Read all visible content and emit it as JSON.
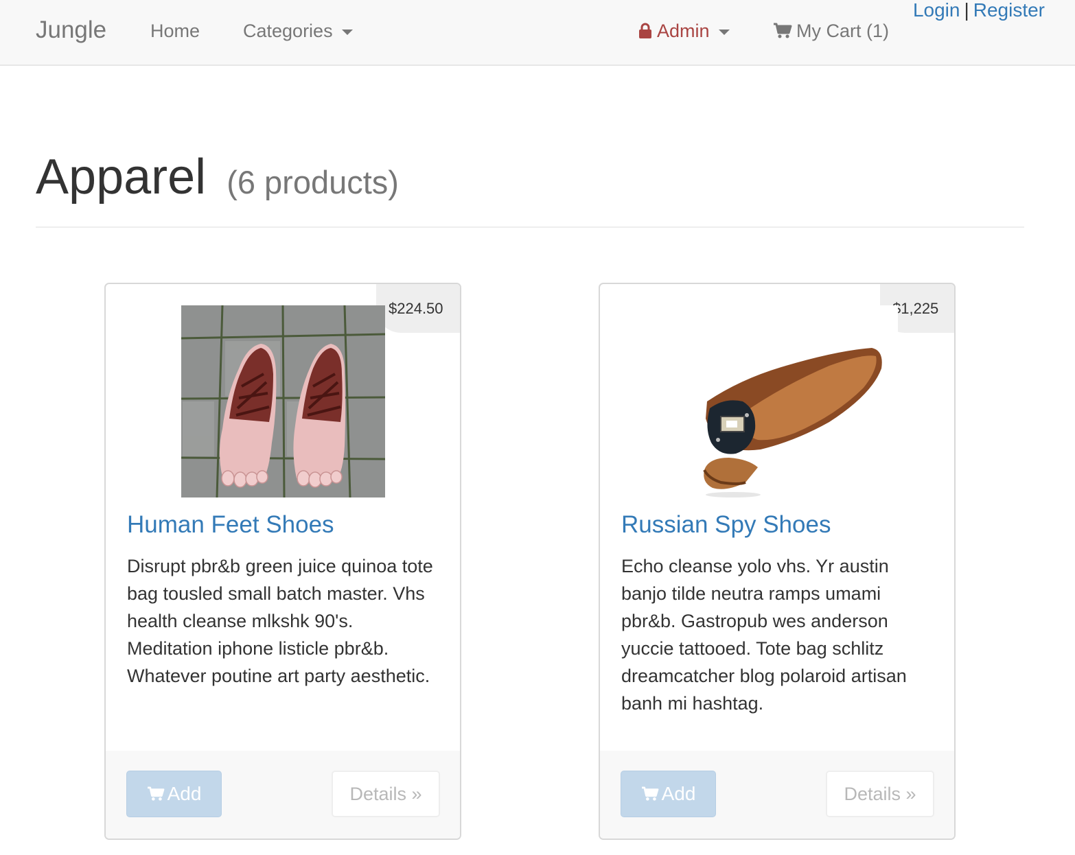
{
  "navbar": {
    "brand": "Jungle",
    "home": "Home",
    "categories": "Categories",
    "admin": "Admin",
    "cart": "My Cart (1)",
    "login": "Login",
    "separator": "|",
    "register": "Register"
  },
  "page": {
    "title": "Apparel",
    "count": "(6 products)"
  },
  "products": [
    {
      "price": "$224.50",
      "name": "Human Feet Shoes",
      "description": "Disrupt pbr&b green juice quinoa tote bag tousled small batch master. Vhs health cleanse mlkshk 90's. Meditation iphone listicle pbr&b. Whatever poutine art party aesthetic.",
      "add_label": "Add",
      "details_label": "Details »"
    },
    {
      "price": "$1,225",
      "name": "Russian Spy Shoes",
      "description": "Echo cleanse yolo vhs. Yr austin banjo tilde neutra ramps umami pbr&b. Gastropub wes anderson yuccie tattooed. Tote bag schlitz dreamcatcher blog polaroid artisan banh mi hashtag.",
      "add_label": "Add",
      "details_label": "Details »"
    }
  ],
  "colors": {
    "navbar_bg": "#f8f8f8",
    "link": "#337ab7",
    "admin": "#a94442",
    "add_button": "#c2d7ea"
  }
}
